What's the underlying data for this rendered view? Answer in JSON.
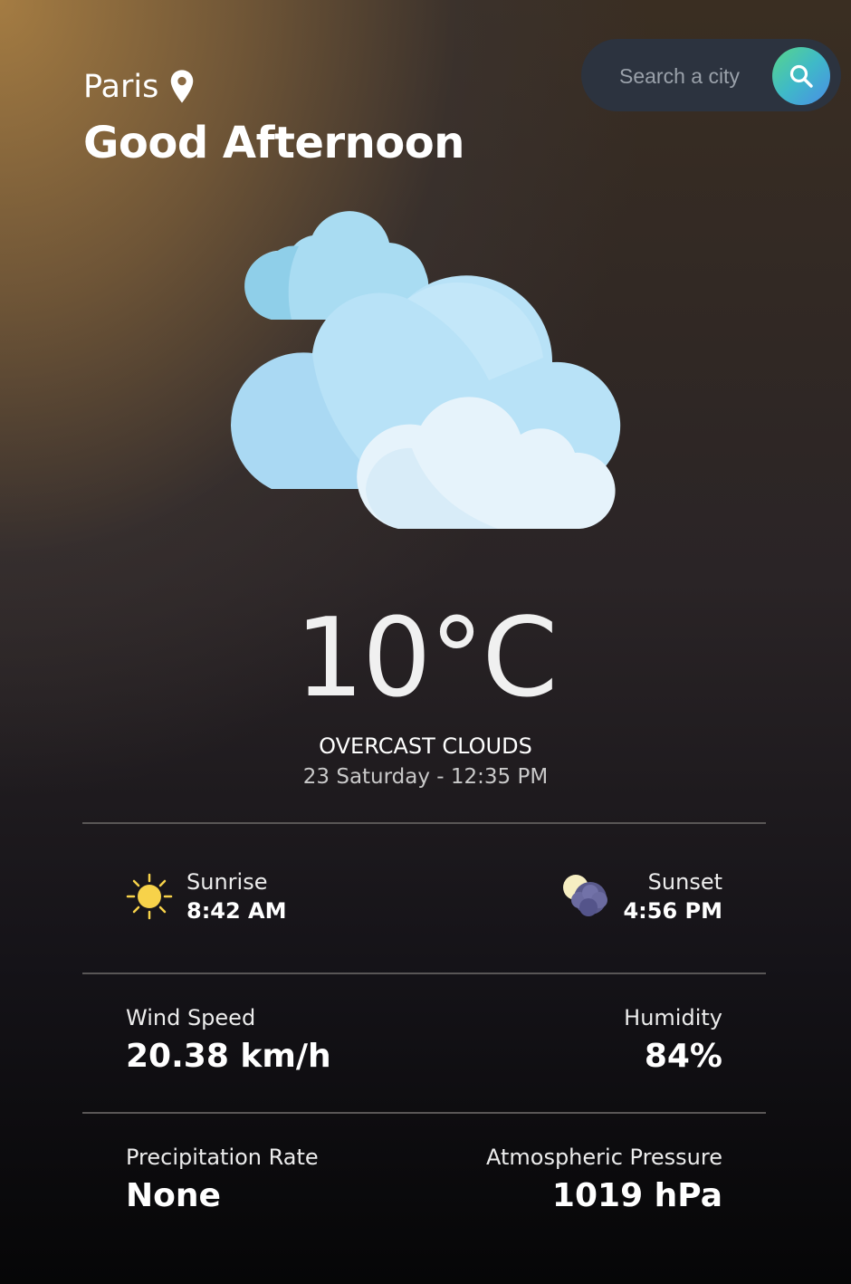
{
  "header": {
    "city": "Paris",
    "greeting": "Good Afternoon"
  },
  "search": {
    "placeholder": "Search a city"
  },
  "current": {
    "icon": "overcast-clouds-icon",
    "temperature": "10°C",
    "description": "OVERCAST CLOUDS",
    "datetime": "23 Saturday - 12:35 PM"
  },
  "sun": {
    "sunrise_label": "Sunrise",
    "sunrise_time": "8:42 AM",
    "sunset_label": "Sunset",
    "sunset_time": "4:56 PM"
  },
  "stats": {
    "wind_label": "Wind Speed",
    "wind_value": "20.38 km/h",
    "humidity_label": "Humidity",
    "humidity_value": "84%",
    "precip_label": "Precipitation Rate",
    "precip_value": "None",
    "pressure_label": "Atmospheric Pressure",
    "pressure_value": "1019 hPa"
  },
  "colors": {
    "search_bg": "#2c333f",
    "search_button_gradient": [
      "#58d68a",
      "#3fb9c8",
      "#4a8de6"
    ],
    "sun": "#f7d24a"
  }
}
